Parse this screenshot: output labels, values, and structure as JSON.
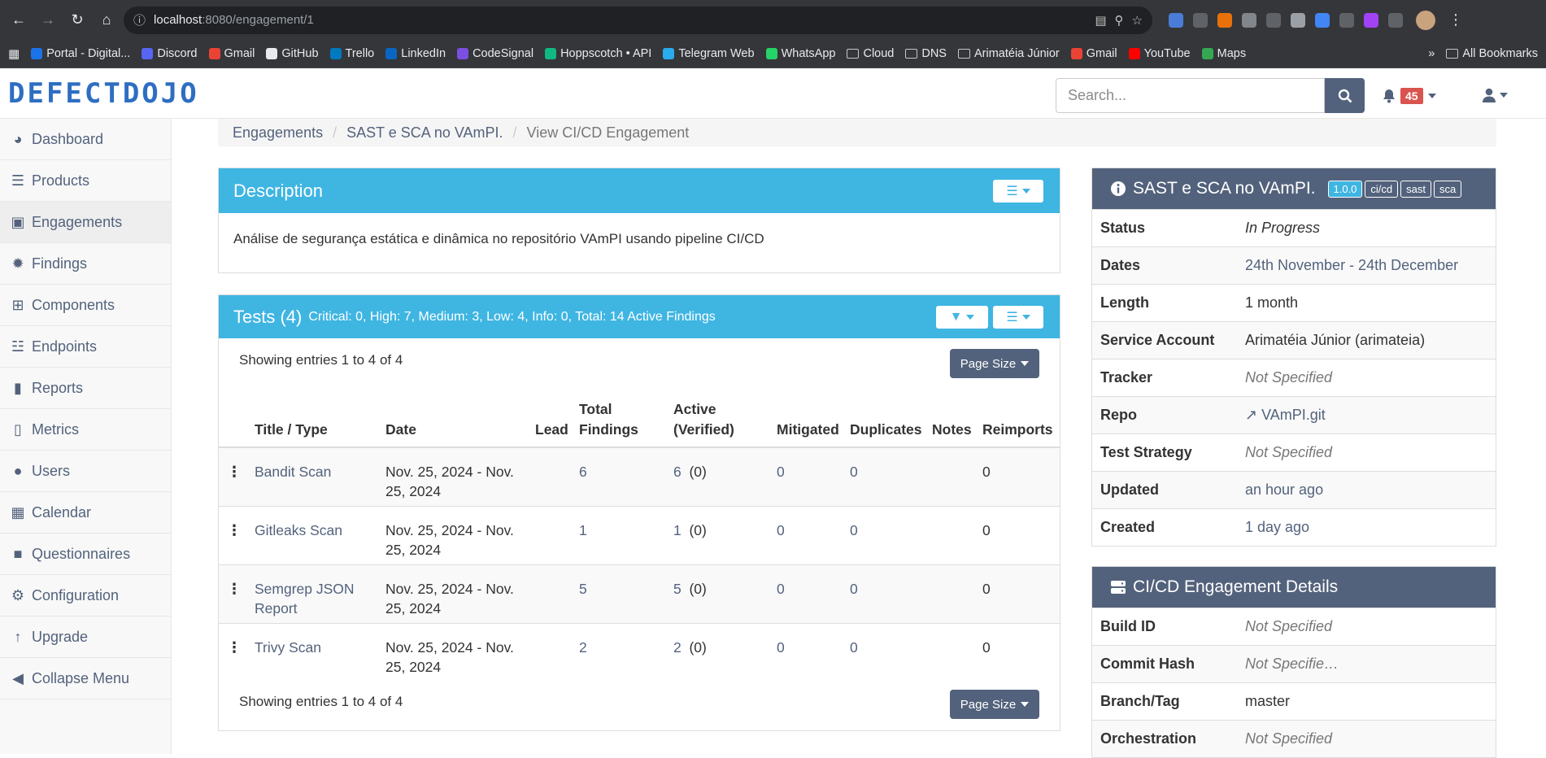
{
  "browser": {
    "url_host": "localhost",
    "url_path": ":8080/engagement/1",
    "bookmarks": [
      {
        "label": "Portal - Digital...",
        "color": "#1a73e8"
      },
      {
        "label": "Discord",
        "color": "#5865f2"
      },
      {
        "label": "Gmail",
        "color": "#ea4335"
      },
      {
        "label": "GitHub",
        "color": "#e8eaed"
      },
      {
        "label": "Trello",
        "color": "#0079bf"
      },
      {
        "label": "LinkedIn",
        "color": "#0a66c2"
      },
      {
        "label": "CodeSignal",
        "color": "#7b4fe0"
      },
      {
        "label": "Hoppscotch • API",
        "color": "#10b981"
      },
      {
        "label": "Telegram Web",
        "color": "#2aabee"
      },
      {
        "label": "WhatsApp",
        "color": "#25d366"
      },
      {
        "label": "Cloud",
        "folder": true
      },
      {
        "label": "DNS",
        "folder": true
      },
      {
        "label": "Arimatéia Júnior",
        "folder": true
      },
      {
        "label": "Gmail",
        "color": "#ea4335"
      },
      {
        "label": "YouTube",
        "color": "#ff0000"
      },
      {
        "label": "Maps",
        "color": "#34a853"
      }
    ],
    "bookmarks_more": "»",
    "all_bookmarks": "All Bookmarks"
  },
  "app": {
    "logo": "DEFECTDOJO",
    "search_placeholder": "Search...",
    "notification_count": "45"
  },
  "sidebar": {
    "items": [
      {
        "label": "Dashboard",
        "icon": "dashboard-icon"
      },
      {
        "label": "Products",
        "icon": "list-icon"
      },
      {
        "label": "Engagements",
        "icon": "inbox-icon"
      },
      {
        "label": "Findings",
        "icon": "bug-icon"
      },
      {
        "label": "Components",
        "icon": "table-icon"
      },
      {
        "label": "Endpoints",
        "icon": "sitemap-icon"
      },
      {
        "label": "Reports",
        "icon": "file-icon"
      },
      {
        "label": "Metrics",
        "icon": "bar-chart-icon"
      },
      {
        "label": "Users",
        "icon": "user-icon"
      },
      {
        "label": "Calendar",
        "icon": "calendar-icon"
      },
      {
        "label": "Questionnaires",
        "icon": "questionnaire-icon"
      },
      {
        "label": "Configuration",
        "icon": "gear-icon"
      },
      {
        "label": "Upgrade",
        "icon": "upgrade-icon"
      },
      {
        "label": "Collapse Menu",
        "icon": "collapse-icon"
      }
    ]
  },
  "breadcrumb": {
    "engagements": "Engagements",
    "engagement": "SAST e SCA no VAmPI.",
    "current": "View CI/CD Engagement"
  },
  "description": {
    "title": "Description",
    "text": "Análise de segurança estática e dinâmica no repositório VAmPI usando pipeline CI/CD"
  },
  "tests": {
    "title": "Tests (4)",
    "summary": "Critical: 0, High: 7, Medium: 3, Low: 4, Info: 0, Total: 14 Active Findings",
    "showing_top": "Showing entries 1 to 4 of 4",
    "showing_bottom": "Showing entries 1 to 4 of 4",
    "page_size": "Page Size",
    "columns": {
      "title": "Title / Type",
      "date": "Date",
      "lead": "Lead",
      "total_1": "Total",
      "total_2": "Findings",
      "active_1": "Active",
      "active_2": "(Verified)",
      "mitigated": "Mitigated",
      "duplicates": "Duplicates",
      "notes": "Notes",
      "reimports": "Reimports"
    },
    "rows": [
      {
        "title": "Bandit Scan",
        "date": "Nov. 25, 2024 - Nov. 25, 2024",
        "lead": "",
        "total": "6",
        "active": "6",
        "verified": "(0)",
        "mitigated": "0",
        "duplicates": "0",
        "notes": "",
        "reimports": "0"
      },
      {
        "title": "Gitleaks Scan",
        "date": "Nov. 25, 2024 - Nov. 25, 2024",
        "lead": "",
        "total": "1",
        "active": "1",
        "verified": "(0)",
        "mitigated": "0",
        "duplicates": "0",
        "notes": "",
        "reimports": "0"
      },
      {
        "title": "Semgrep JSON Report",
        "date": "Nov. 25, 2024 - Nov. 25, 2024",
        "lead": "",
        "total": "5",
        "active": "5",
        "verified": "(0)",
        "mitigated": "0",
        "duplicates": "0",
        "notes": "",
        "reimports": "0"
      },
      {
        "title": "Trivy Scan",
        "date": "Nov. 25, 2024 - Nov. 25, 2024",
        "lead": "",
        "total": "2",
        "active": "2",
        "verified": "(0)",
        "mitigated": "0",
        "duplicates": "0",
        "notes": "",
        "reimports": "0"
      }
    ]
  },
  "engagement_info": {
    "title": "SAST e SCA no VAmPI.",
    "tags": [
      "1.0.0",
      "ci/cd",
      "sast",
      "sca"
    ],
    "fields": [
      {
        "key": "Status",
        "value": "In Progress",
        "style": "italic"
      },
      {
        "key": "Dates",
        "value": "24th November - 24th December",
        "style": "link"
      },
      {
        "key": "Length",
        "value": "1 month",
        "style": "plain"
      },
      {
        "key": "Service Account",
        "value": "Arimatéia Júnior (arimateia)",
        "style": "plain"
      },
      {
        "key": "Tracker",
        "value": "Not Specified",
        "style": "muted"
      },
      {
        "key": "Repo",
        "value": "VAmPI.git",
        "style": "link"
      },
      {
        "key": "Test Strategy",
        "value": "Not Specified",
        "style": "muted"
      },
      {
        "key": "Updated",
        "value": "an hour ago",
        "style": "link"
      },
      {
        "key": "Created",
        "value": "1 day ago",
        "style": "link"
      }
    ]
  },
  "cicd": {
    "title": "CI/CD Engagement Details",
    "fields": [
      {
        "key": "Build ID",
        "value": "Not Specified",
        "style": "muted"
      },
      {
        "key": "Commit Hash",
        "value": "Not Specifie…",
        "style": "muted"
      },
      {
        "key": "Branch/Tag",
        "value": "master",
        "style": "plain"
      },
      {
        "key": "Orchestration",
        "value": "Not Specified",
        "style": "muted"
      }
    ]
  },
  "colors": {
    "primary": "#53627c",
    "info_heading": "#3fb5e2",
    "danger_badge": "#d9534f"
  }
}
